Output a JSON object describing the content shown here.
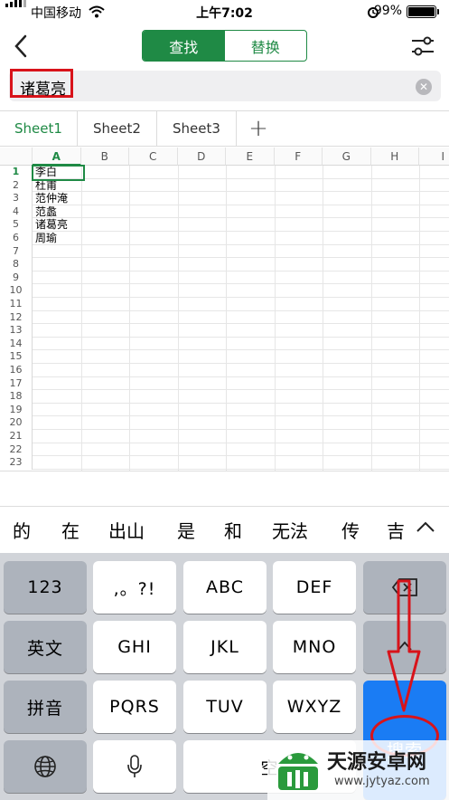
{
  "status_bar": {
    "carrier": "中国移动",
    "time": "上午7:02",
    "battery": "99%"
  },
  "top_bar": {
    "segments": [
      "查找",
      "替换"
    ],
    "active_segment": "查找"
  },
  "search": {
    "value": "诸葛亮"
  },
  "sheet_tabs": [
    "Sheet1",
    "Sheet2",
    "Sheet3"
  ],
  "active_sheet": "Sheet1",
  "grid": {
    "columns": [
      "A",
      "B",
      "C",
      "D",
      "E",
      "F",
      "G",
      "H",
      "I"
    ],
    "rows": [
      "1",
      "2",
      "3",
      "4",
      "5",
      "6",
      "7",
      "8",
      "9",
      "10",
      "11",
      "12",
      "13",
      "14",
      "15",
      "16",
      "17",
      "18",
      "19",
      "20",
      "21",
      "22",
      "23"
    ],
    "cells_A": [
      "李白",
      "杜甫",
      "范仲淹",
      "范蠡",
      "诸葛亮",
      "周瑜"
    ],
    "selected_cell": "A1"
  },
  "candidates": [
    "的",
    "在",
    "出山",
    "是",
    "和",
    "无法",
    "传",
    "吉"
  ],
  "keyboard": {
    "row1": [
      "123",
      ",。?!",
      "ABC",
      "DEF"
    ],
    "row2": [
      "英文",
      "GHI",
      "JKL",
      "MNO"
    ],
    "row3": [
      "拼音",
      "PQRS",
      "TUV",
      "WXYZ"
    ],
    "search_key": "搜索",
    "space_key": "空"
  },
  "watermark": {
    "text": "天源安卓网",
    "url": "www.jytyaz.com"
  },
  "colors": {
    "accent": "#1f8a45",
    "annotation": "#d8131a",
    "key_blue": "#1a7cf4"
  }
}
